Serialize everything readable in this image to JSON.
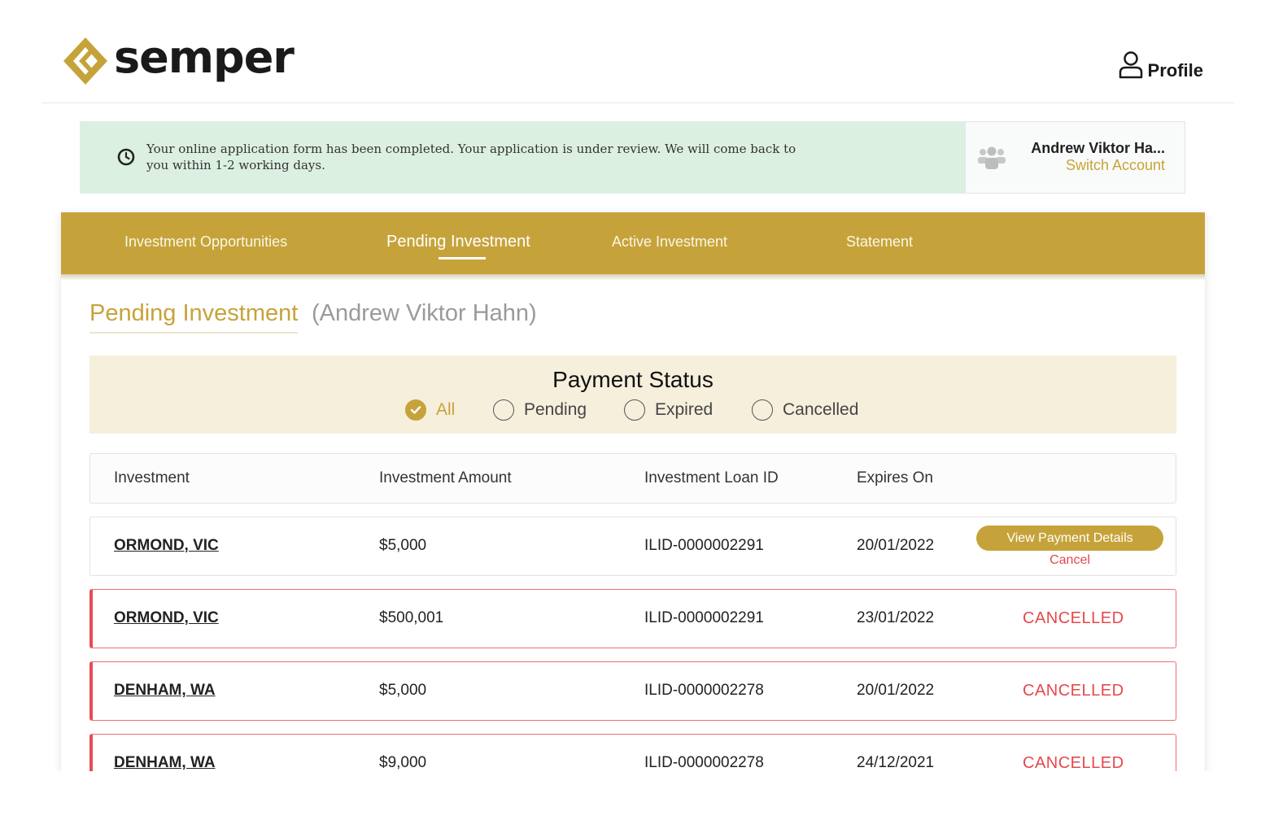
{
  "brand": {
    "name": "semper",
    "accent": "#c6a33a"
  },
  "header": {
    "profile_label": "Profile"
  },
  "notice": {
    "message": "Your online application form has been completed. Your application is under review. We will come back to you within 1-2 working days."
  },
  "account": {
    "name": "Andrew Viktor Ha...",
    "switch_label": "Switch Account"
  },
  "nav": {
    "tabs": [
      {
        "label": "Investment Opportunities"
      },
      {
        "label": "Pending Investment",
        "active": true
      },
      {
        "label": "Active Investment"
      },
      {
        "label": "Statement"
      }
    ]
  },
  "page": {
    "title": "Pending Investment",
    "subtitle": "(Andrew Viktor Hahn)"
  },
  "filter": {
    "title": "Payment Status",
    "options": [
      {
        "label": "All",
        "checked": true
      },
      {
        "label": "Pending",
        "checked": false
      },
      {
        "label": "Expired",
        "checked": false
      },
      {
        "label": "Cancelled",
        "checked": false
      }
    ]
  },
  "table": {
    "columns": [
      "Investment",
      "Investment Amount",
      "Investment Loan ID",
      "Expires On"
    ],
    "rows": [
      {
        "investment": "ORMOND, VIC",
        "amount": "$5,000",
        "loan_id": "ILID-0000002291",
        "expires": "20/01/2022",
        "status": "",
        "view_label": "View Payment Details",
        "cancel_label": "Cancel"
      },
      {
        "investment": "ORMOND, VIC",
        "amount": "$500,001",
        "loan_id": "ILID-0000002291",
        "expires": "23/01/2022",
        "status": "CANCELLED"
      },
      {
        "investment": "DENHAM, WA",
        "amount": "$5,000",
        "loan_id": "ILID-0000002278",
        "expires": "20/01/2022",
        "status": "CANCELLED"
      },
      {
        "investment": "DENHAM, WA",
        "amount": "$9,000",
        "loan_id": "ILID-0000002278",
        "expires": "24/12/2021",
        "status": "CANCELLED"
      }
    ]
  }
}
